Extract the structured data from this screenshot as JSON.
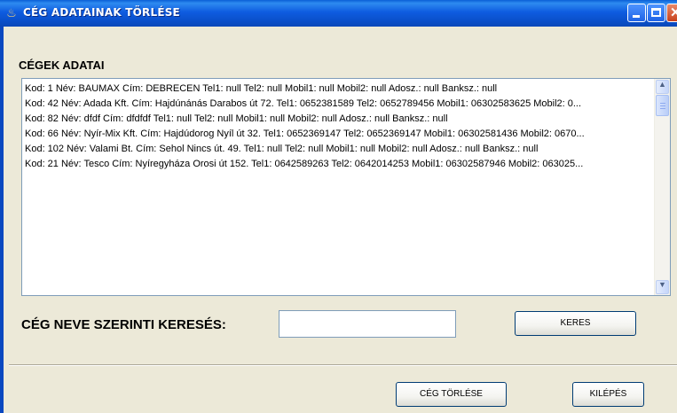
{
  "window": {
    "title": "CÉG ADATAINAK TÖRLÉSE"
  },
  "section": {
    "label": "CÉGEK ADATAI"
  },
  "list": {
    "items": [
      "Kod: 1 Név: BAUMAX Cím: DEBRECEN Tel1: null Tel2: null Mobil1: null Mobil2: null Adosz.: null Banksz.: null",
      "Kod: 42 Név: Adada Kft. Cím: Hajdúnánás Darabos út 72. Tel1: 0652381589 Tel2: 0652789456 Mobil1: 06302583625 Mobil2: 0...",
      "Kod: 82 Név: dfdf Cím: dfdfdf Tel1: null Tel2: null Mobil1: null Mobil2: null Adosz.: null Banksz.: null",
      "Kod: 66 Név: Nyír-Mix Kft. Cím: Hajdúdorog Nyíl út 32. Tel1: 0652369147 Tel2: 0652369147 Mobil1: 06302581436 Mobil2: 0670...",
      "Kod: 102 Név: Valami Bt. Cím: Sehol Nincs út. 49. Tel1: null Tel2: null Mobil1: null Mobil2: null Adosz.: null Banksz.: null",
      "Kod: 21 Név: Tesco Cím: Nyíregyháza Orosi út 152. Tel1: 0642589263 Tel2: 0642014253 Mobil1: 06302587946 Mobil2: 063025..."
    ]
  },
  "search": {
    "label": "CÉG NEVE SZERINTI KERESÉS:",
    "value": "",
    "button_label": "KERES"
  },
  "footer": {
    "delete_label": "CÉG TÖRLÉSE",
    "exit_label": "KILÉPÉS"
  },
  "colors": {
    "titlebar": "#0a5fd6",
    "background": "#ece9d8",
    "close": "#c8401b"
  }
}
